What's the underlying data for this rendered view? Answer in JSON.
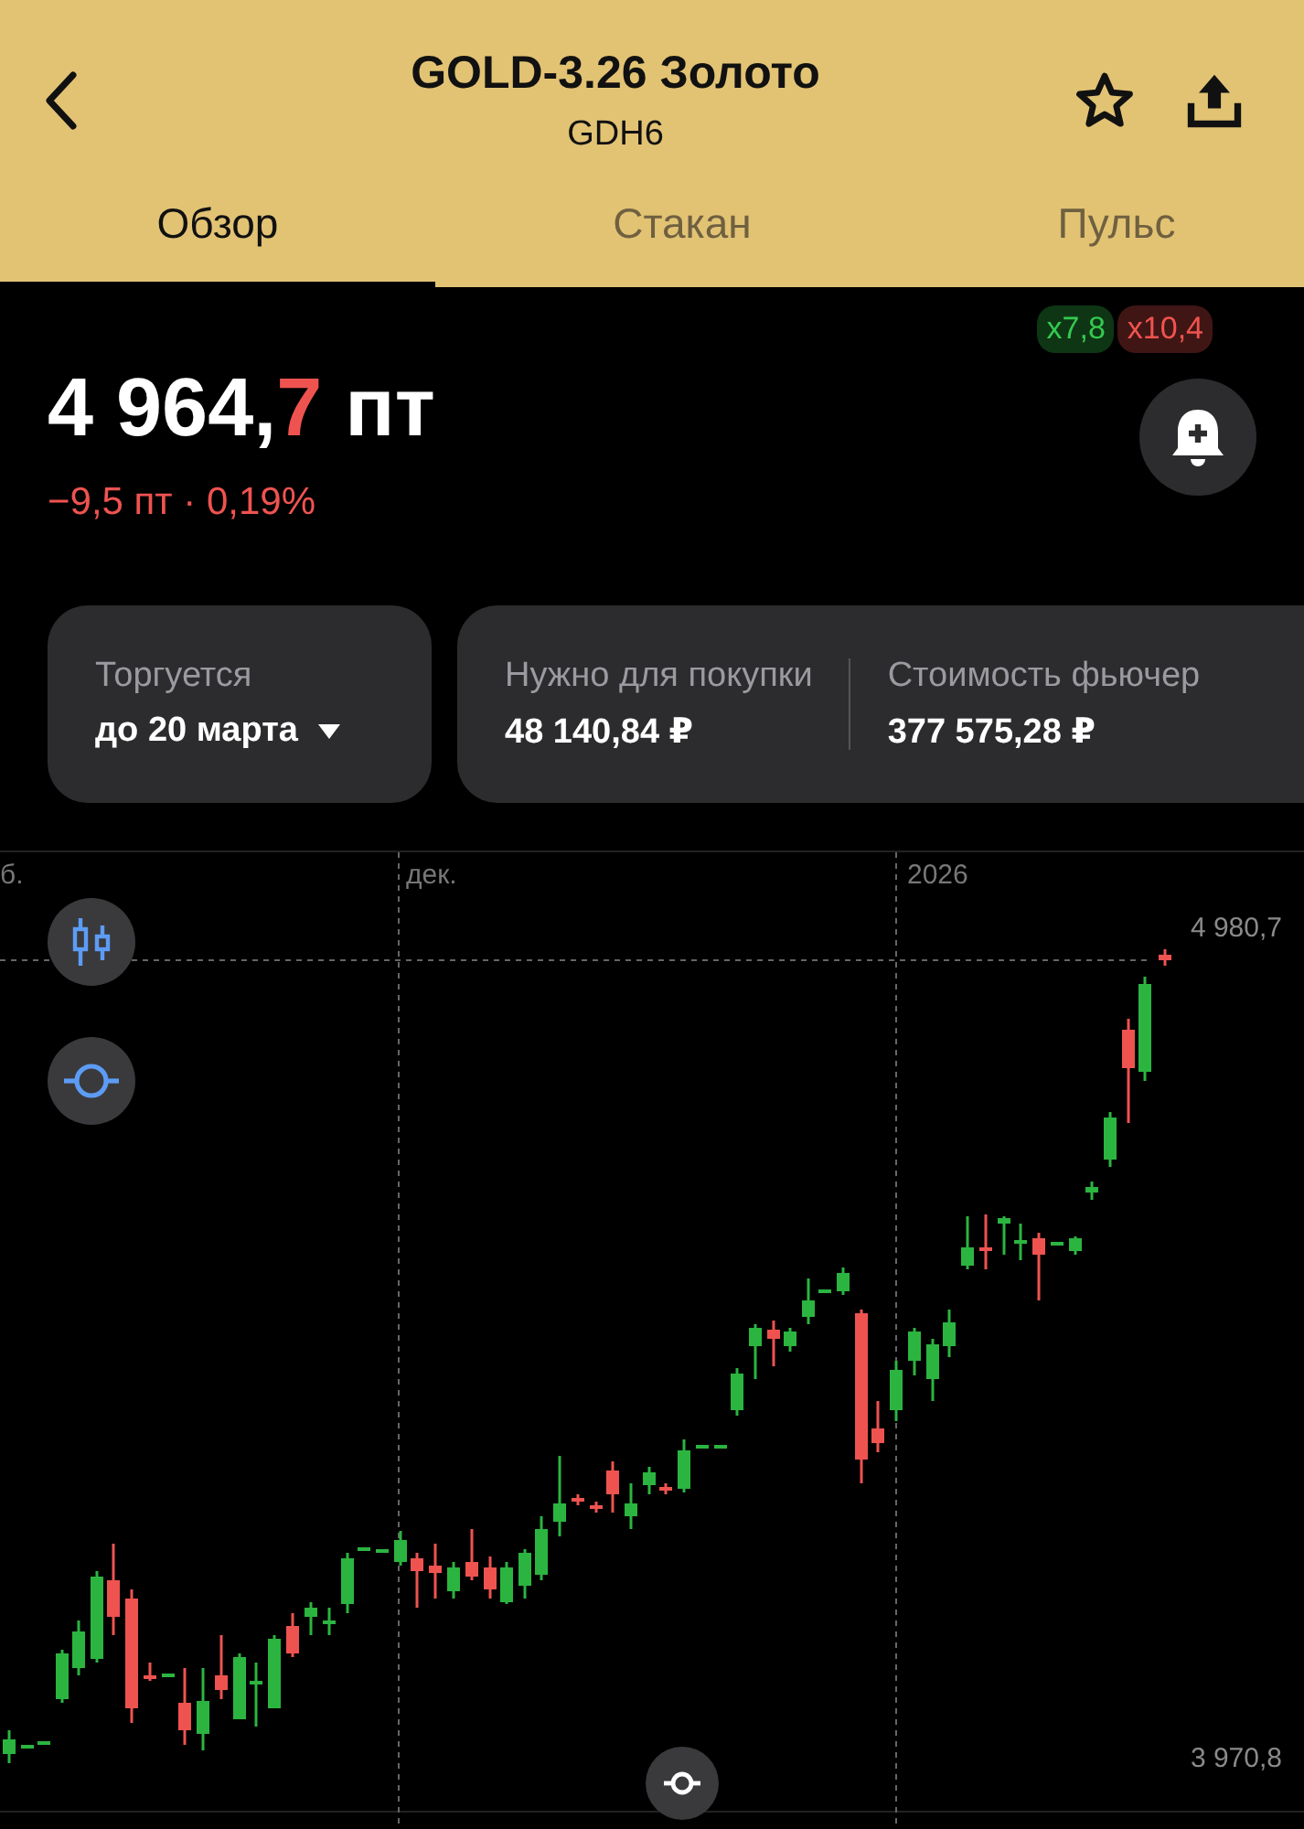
{
  "header": {
    "title": "GOLD-3.26 Золото",
    "subtitle": "GDH6"
  },
  "tabs": [
    {
      "label": "Обзор",
      "selected": true
    },
    {
      "label": "Стакан",
      "selected": false
    },
    {
      "label": "Пульс",
      "selected": false
    }
  ],
  "quote": {
    "price_main": "4 964,",
    "price_last_digit": "7",
    "unit": "пт",
    "change": "−9,5 пт · 0,19%"
  },
  "badges": [
    {
      "text": "x7,8",
      "color": "#35c94f"
    },
    {
      "text": "x10,4",
      "color": "#f0534f"
    }
  ],
  "cards": [
    {
      "label": "Торгуется",
      "value": "до 20 марта",
      "dropdown": true
    },
    {
      "label": "Нужно для покупки",
      "value": "48 140,84 ₽",
      "dropdown": false
    },
    {
      "label": "Стоимость фьючер",
      "value": "377 575,28 ₽",
      "dropdown": false
    }
  ],
  "chart": {
    "x_labels": [
      "б.",
      "дек.",
      "2026"
    ],
    "high_label": "4 980,7",
    "low_label": "3 970,8"
  }
}
